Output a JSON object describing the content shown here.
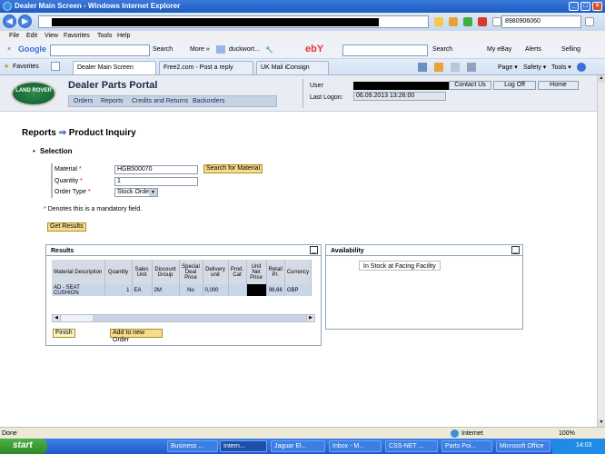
{
  "window": {
    "title": "Dealer Main Screen - Windows Internet Explorer"
  },
  "browser": {
    "search_value": "8980906060",
    "menu": [
      "File",
      "Edit",
      "View",
      "Favorites",
      "Tools",
      "Help"
    ],
    "google_label": "Google",
    "toolbar": {
      "search": "Search",
      "more": "More »",
      "user": "duckwort...",
      "ebay": "ebY",
      "search2": "Search",
      "myebay": "My eBay",
      "alerts": "Alerts",
      "selling": "Selling"
    },
    "favorites_label": "Favorites",
    "tabs": [
      "Dealer Main Screen",
      "Free2.com - Post a reply",
      "UK Mail iConsign"
    ],
    "cmd": [
      "Page ▾",
      "Safety ▾",
      "Tools ▾"
    ]
  },
  "portal": {
    "logo": "LAND ROVER",
    "title": "Dealer Parts Portal",
    "nav": [
      "Orders",
      "Reports",
      "Credits and Returns",
      "Backorders"
    ],
    "user_label": "User",
    "last_logon_label": "Last Logon:",
    "last_logon_value": "06.09.2013 13:26:00",
    "buttons": {
      "contact": "Contact Us",
      "logoff": "Log Off",
      "home": "Home"
    }
  },
  "page": {
    "crumb_reports": "Reports",
    "crumb_arrow": "⇒",
    "crumb_page": "Product Inquiry",
    "selection": "Selection",
    "fields": {
      "material_label": "Material",
      "material_value": "HGB500070",
      "quantity_label": "Quantity",
      "quantity_value": "1",
      "order_type_label": "Order Type",
      "order_type_value": "Stock Order"
    },
    "search_material": "Search for Material",
    "mandatory_note": "Denotes this is a mandatory field.",
    "get_results": "Get Results"
  },
  "results": {
    "title": "Results",
    "columns": [
      "Material Description",
      "Quantity",
      "Sales Unit",
      "Discount Group",
      "Special Deal Price",
      "Delivery unit",
      "Prod. Cat",
      "Unit Net Price",
      "Retail Pr.",
      "Currency"
    ],
    "row": [
      "AD - SEAT CUSHION",
      "1",
      "EA",
      "2M",
      "No",
      "0,000",
      "",
      "",
      "98,66",
      "GBP"
    ],
    "finish": "Finish",
    "add_to_order": "Add to new Order"
  },
  "availability": {
    "title": "Availability",
    "status": "In Stock at Facing Facility"
  },
  "statusbar": {
    "left": "Done",
    "zone": "Internet",
    "zoom": "100%"
  },
  "taskbar": {
    "start": "start",
    "items": [
      "Business ...",
      "Intern...",
      "Jaguar El...",
      "Inbox - M...",
      "CSS-NET ...",
      "Parts Poi...",
      "Microsoft Office"
    ],
    "clock": "14:03"
  }
}
